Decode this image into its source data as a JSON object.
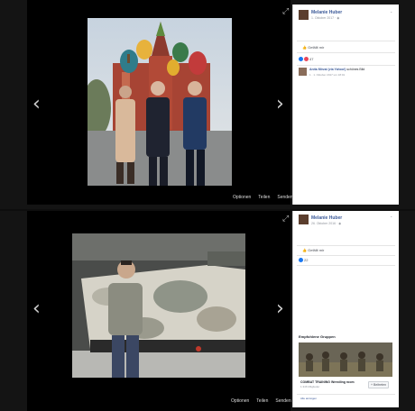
{
  "posts": [
    {
      "author": "Melanie Huber",
      "date": "1. Oktober 2017 · ",
      "like_label": "Gefällt mir",
      "reactions_count": "47",
      "comment_author": "Anita Mirzai (via Yahoo!)",
      "comment_text": "schönes Bild",
      "comment_meta": "1 · 1. Oktober 2017 um 18:01",
      "actions": [
        "Optionen",
        "Teilen",
        "Senden"
      ]
    },
    {
      "author": "Melanie Huber",
      "date": "26. Oktober 2016 · ",
      "like_label": "Gefällt mir",
      "reactions_count": "22",
      "suggested_title": "Empfohlene Gruppen",
      "group_name": "COMBAT TRAINING Wrestling room",
      "group_members": "1.346 Mitglieder",
      "join_label": "+ Beitreten",
      "see_all": "Alle anzeigen",
      "actions": [
        "Optionen",
        "Teilen",
        "Senden"
      ]
    }
  ],
  "icons": {
    "prev": "chevron-left-icon",
    "next": "chevron-right-icon",
    "fullscreen": "expand-icon",
    "globe": "globe-icon"
  },
  "colors": {
    "link": "#3b5998",
    "like_blue": "#1877f2",
    "love_red": "#e9475b"
  }
}
